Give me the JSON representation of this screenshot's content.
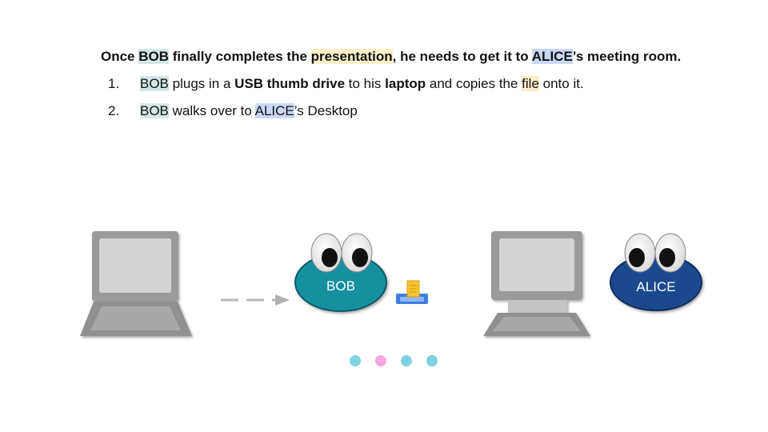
{
  "headline": {
    "p1": "Once ",
    "bob": "BOB",
    "p2": " finally completes the ",
    "presentation": "presentation",
    "p3": ", he needs to get it to ",
    "alice": "ALICE",
    "p4": "’s meeting room."
  },
  "steps": [
    {
      "num": "1.",
      "bob": "BOB",
      "t1": " plugs in a ",
      "usb": "USB thumb drive",
      "t2": " to his ",
      "laptop": "laptop",
      "t3": " and copies the ",
      "file": "file",
      "t4": " onto it."
    },
    {
      "num": "2.",
      "bob": "BOB",
      "t1": " walks over to ",
      "alice": "ALICE",
      "t2": "’s Desktop"
    }
  ],
  "characters": {
    "bob": {
      "label": "BOB",
      "color": "#13909f"
    },
    "alice": {
      "label": "ALICE",
      "color": "#1b4a8e"
    }
  },
  "icons": {
    "laptop": "laptop-icon",
    "desktop": "desktop-computer-icon",
    "arrow": "dashed-arrow-icon",
    "usb": "usb-drive-with-file-icon"
  },
  "progress_dots": [
    {
      "color": "#7fd3e0",
      "active": false
    },
    {
      "color": "#f4a9e0",
      "active": true
    },
    {
      "color": "#7fd3e0",
      "active": false
    },
    {
      "color": "#7fd3e0",
      "active": false
    }
  ]
}
